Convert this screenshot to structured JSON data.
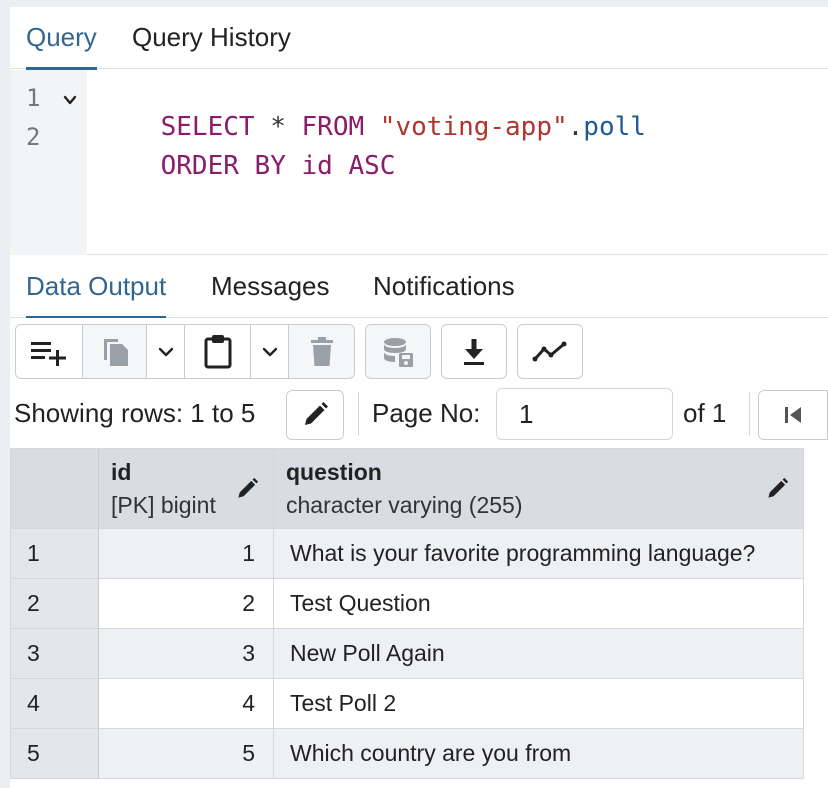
{
  "query_tabs": [
    {
      "label": "Query",
      "active": true
    },
    {
      "label": "Query History",
      "active": false
    }
  ],
  "editor": {
    "lines": [
      {
        "number": "1",
        "tokens": [
          {
            "text": "SELECT",
            "kind": "kw"
          },
          {
            "text": " * ",
            "kind": "op"
          },
          {
            "text": "FROM",
            "kind": "kw"
          },
          {
            "text": " ",
            "kind": "op"
          },
          {
            "text": "\"voting-app\"",
            "kind": "str"
          },
          {
            "text": ".",
            "kind": "op"
          },
          {
            "text": "poll",
            "kind": "id"
          }
        ]
      },
      {
        "number": "2",
        "tokens": [
          {
            "text": "ORDER BY id ASC",
            "kind": "kw"
          }
        ]
      }
    ]
  },
  "output_tabs": [
    {
      "label": "Data Output",
      "active": true
    },
    {
      "label": "Messages",
      "active": false
    },
    {
      "label": "Notifications",
      "active": false
    }
  ],
  "toolbar": {
    "buttons": [
      "add-row-icon",
      "copy-icon",
      "chevron-down-icon",
      "paste-icon",
      "chevron-down-icon",
      "delete-icon",
      "save-data-icon",
      "download-icon",
      "graph-icon"
    ]
  },
  "pager": {
    "showing": "Showing rows: 1 to 5",
    "page_label": "Page No:",
    "page_value": "1",
    "of_label": "of 1"
  },
  "grid": {
    "columns": [
      {
        "name": "id",
        "type": "[PK] bigint"
      },
      {
        "name": "question",
        "type": "character varying (255)"
      }
    ],
    "rows": [
      {
        "n": "1",
        "id": "1",
        "question": "What is your favorite programming language?"
      },
      {
        "n": "2",
        "id": "2",
        "question": "Test Question"
      },
      {
        "n": "3",
        "id": "3",
        "question": "New Poll Again"
      },
      {
        "n": "4",
        "id": "4",
        "question": "Test Poll 2"
      },
      {
        "n": "5",
        "id": "5",
        "question": "Which country are you from"
      }
    ]
  },
  "colors": {
    "accent": "#326690",
    "keyword": "#8b1c6a",
    "string": "#b0352f",
    "identifier": "#1f5a96",
    "header_bg": "#d8dce3"
  }
}
